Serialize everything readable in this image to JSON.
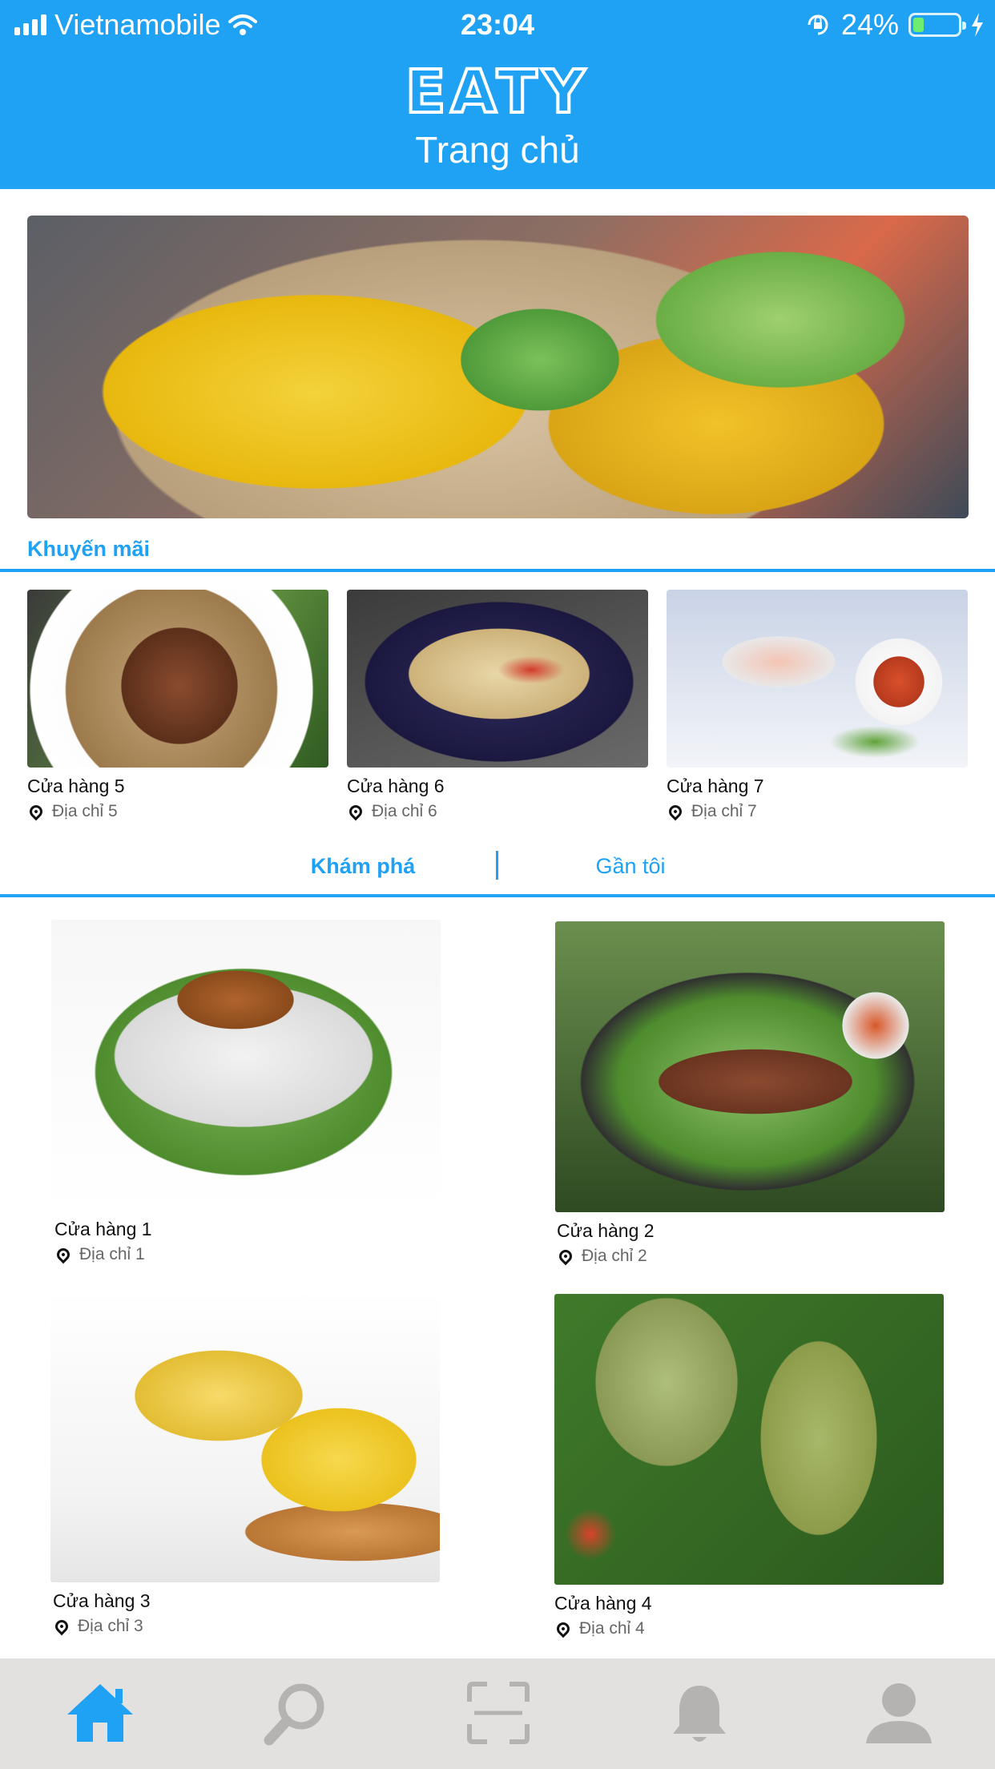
{
  "status_bar": {
    "carrier": "Vietnamobile",
    "time": "23:04",
    "battery": "24%",
    "battery_level": 0.24
  },
  "header": {
    "logo": "EATY",
    "title": "Trang chủ"
  },
  "promo": {
    "title": "Khuyến mãi",
    "items": [
      {
        "name": "Cửa hàng 5",
        "address": "Địa chỉ 5"
      },
      {
        "name": "Cửa hàng 6",
        "address": "Địa chỉ 6"
      },
      {
        "name": "Cửa hàng 7",
        "address": "Địa chỉ 7"
      }
    ]
  },
  "tabs": [
    {
      "label": "Khám phá",
      "active": true
    },
    {
      "label": "Gần tôi",
      "active": false
    }
  ],
  "stores": [
    {
      "name": "Cửa hàng 1",
      "address": "Địa chỉ 1"
    },
    {
      "name": "Cửa hàng 2",
      "address": "Địa chỉ 2"
    },
    {
      "name": "Cửa hàng 3",
      "address": "Địa chỉ 3"
    },
    {
      "name": "Cửa hàng 4",
      "address": "Địa chỉ 4"
    }
  ],
  "bottom_nav": [
    {
      "icon": "home-icon",
      "active": true
    },
    {
      "icon": "search-icon",
      "active": false
    },
    {
      "icon": "scan-icon",
      "active": false
    },
    {
      "icon": "bell-icon",
      "active": false
    },
    {
      "icon": "user-icon",
      "active": false
    }
  ],
  "colors": {
    "accent": "#1FA1F4",
    "nav_background": "#E3E1DF",
    "nav_inactive": "#B5B3B1"
  }
}
